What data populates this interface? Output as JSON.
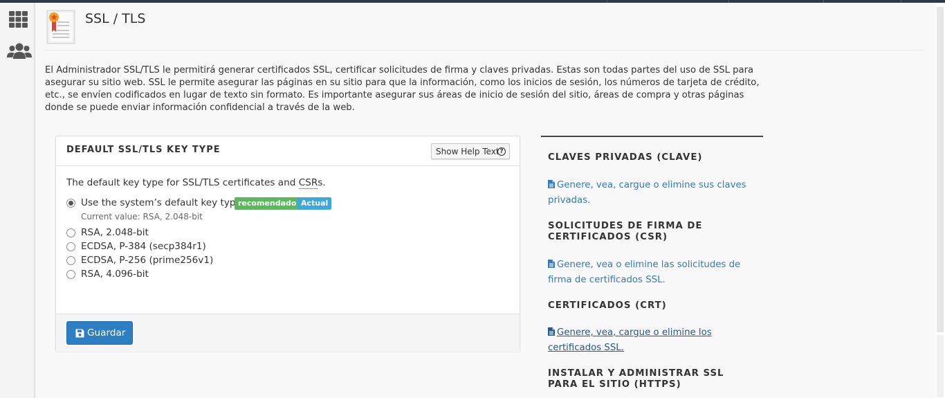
{
  "page": {
    "title": "SSL / TLS",
    "intro": "El Administrador SSL/TLS le permitirá generar certificados SSL, certificar solicitudes de firma y claves privadas. Estas son todas partes del uso de SSL para asegurar su sitio web. SSL le permite asegurar las páginas en su sitio para que la información, como los inicios de sesión, los números de tarjeta de crédito, etc., se envíen codificados en lugar de texto sin formato. Es importante asegurar sus áreas de inicio de sesión del sitio, áreas de compra y otras páginas donde se puede enviar información confidencial a través de la web."
  },
  "sidebar": {
    "icons": [
      "apps-grid-icon",
      "users-icon"
    ]
  },
  "panel": {
    "title": "DEFAULT SSL/TLS KEY TYPE",
    "help_button": "Show Help Text",
    "description_prefix": "The default key type for SSL/TLS certificates and ",
    "description_abbr": "CSR",
    "description_suffix": "s.",
    "options": [
      {
        "label": "Use the system’s default key type.",
        "checked": true
      },
      {
        "label": "RSA, 2.048-bit",
        "checked": false
      },
      {
        "label": "ECDSA, P-384 (secp384r1)",
        "checked": false
      },
      {
        "label": "ECDSA, P-256 (prime256v1)",
        "checked": false
      },
      {
        "label": "RSA, 4.096-bit",
        "checked": false
      }
    ],
    "badges": {
      "recommended": "recomendado",
      "current": "Actual"
    },
    "current_value": "Current value: RSA, 2.048-bit",
    "save_button": "Guardar"
  },
  "side": {
    "sections": [
      {
        "heading": "CLAVES PRIVADAS (CLAVE)",
        "link": "Genere, vea, cargue o elimine sus claves privadas."
      },
      {
        "heading": "SOLICITUDES DE FIRMA DE CERTIFICADOS (CSR)",
        "link": "Genere, vea o elimine las solicitudes de firma de certificados SSL."
      },
      {
        "heading": "CERTIFICADOS (CRT)",
        "link": "Genere, vea, cargue o elimine los certificados SSL."
      },
      {
        "heading": "INSTALAR Y ADMINISTRAR SSL PARA EL SITIO (HTTPS)"
      }
    ]
  },
  "colors": {
    "link": "#337ab7",
    "primary_button": "#2e7ec2",
    "badge_green": "#5cb85c",
    "badge_blue": "#3ea7db",
    "topbar": "#293a4a"
  }
}
